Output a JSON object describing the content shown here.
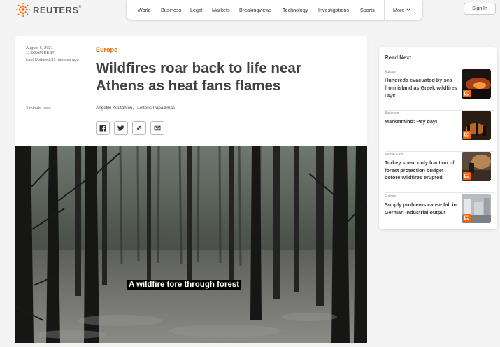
{
  "brand": {
    "name": "REUTERS",
    "mark": "®"
  },
  "nav": {
    "items": [
      "World",
      "Business",
      "Legal",
      "Markets",
      "Breakingviews",
      "Technology",
      "Investigations",
      "Sports"
    ],
    "more_label": "More",
    "signin_label": "Sign In"
  },
  "article": {
    "date": "August 6, 2021",
    "time": "11:08 AM EEST",
    "updated": "Last Updated 31 minutes ago",
    "read_time": "4 minute read",
    "section": "Europe",
    "headline": "Wildfires roar back to life near Athens as heat fans flames",
    "authors": [
      "Angeliki Koutantou,",
      "Lefteris Papadimas"
    ],
    "share_icons": [
      "facebook-icon",
      "twitter-icon",
      "link-icon",
      "email-icon"
    ]
  },
  "video": {
    "caption": "A wildfire tore through forest"
  },
  "read_next": {
    "title": "Read Next",
    "items": [
      {
        "category": "Europe",
        "headline": "Hundreds evacuated by sea from island as Greek wildfires rage"
      },
      {
        "category": "Business",
        "headline": "Marketmind: Pay day!"
      },
      {
        "category": "Middle East",
        "headline": "Turkey spent only fraction of forest protection budget before wildfires erupted"
      },
      {
        "category": "Europe",
        "headline": "Supply problems cause fall in German industrial output"
      }
    ]
  },
  "colors": {
    "accent": "#e06a13",
    "badge": "#fa6400",
    "text": "#404040"
  }
}
